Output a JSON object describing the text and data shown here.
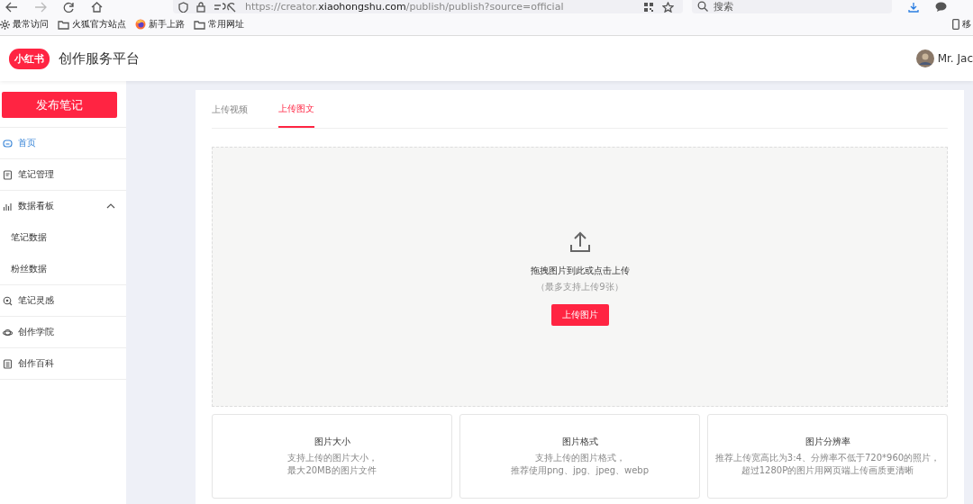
{
  "browser": {
    "url_scheme": "https://creator.",
    "url_domain": "xiaohongshu.com",
    "url_path": "/publish/publish?source=official",
    "search": {
      "placeholder": "搜索"
    },
    "bookmarks": [
      {
        "kind": "gear",
        "label": "最常访问"
      },
      {
        "kind": "folder",
        "label": "火狐官方站点"
      },
      {
        "kind": "firefox",
        "label": "新手上路"
      },
      {
        "kind": "folder",
        "label": "常用网址"
      }
    ],
    "mobile_bookmark": "移"
  },
  "header": {
    "logo": "小红书",
    "title": "创作服务平台",
    "user": "Mr. Jac"
  },
  "sidebar": {
    "publish_button": "发布笔记",
    "items": [
      {
        "kind": "home",
        "label": "首页",
        "selected": true
      },
      {
        "kind": "note",
        "label": "笔记管理",
        "selected": false
      },
      {
        "kind": "chart",
        "label": "数据看板",
        "selected": false,
        "expanded": true,
        "children": [
          {
            "label": "笔记数据",
            "selected": false
          },
          {
            "label": "粉丝数据",
            "selected": false
          }
        ]
      },
      {
        "kind": "bulb",
        "label": "笔记灵感",
        "selected": false
      },
      {
        "kind": "planet",
        "label": "创作学院",
        "selected": false
      },
      {
        "kind": "doc",
        "label": "创作百科",
        "selected": false
      }
    ]
  },
  "tabs": [
    {
      "label": "上传视频",
      "selected": false
    },
    {
      "label": "上传图文",
      "selected": true
    }
  ],
  "upload": {
    "prompt": "拖拽图片到此或点击上传",
    "hint": "（最多支持上传9张）",
    "button": "上传图片"
  },
  "info_cards": [
    {
      "title": "图片大小",
      "lines": [
        "支持上传的图片大小，",
        "最大20MB的图片文件"
      ]
    },
    {
      "title": "图片格式",
      "lines": [
        "支持上传的图片格式，",
        "推荐使用png、jpg、jpeg、webp"
      ]
    },
    {
      "title": "图片分辨率",
      "lines": [
        "推荐上传宽高比为3:4、分辨率不低于720*960的照片，",
        "超过1280P的图片用网页端上传画质更清晰"
      ]
    }
  ]
}
